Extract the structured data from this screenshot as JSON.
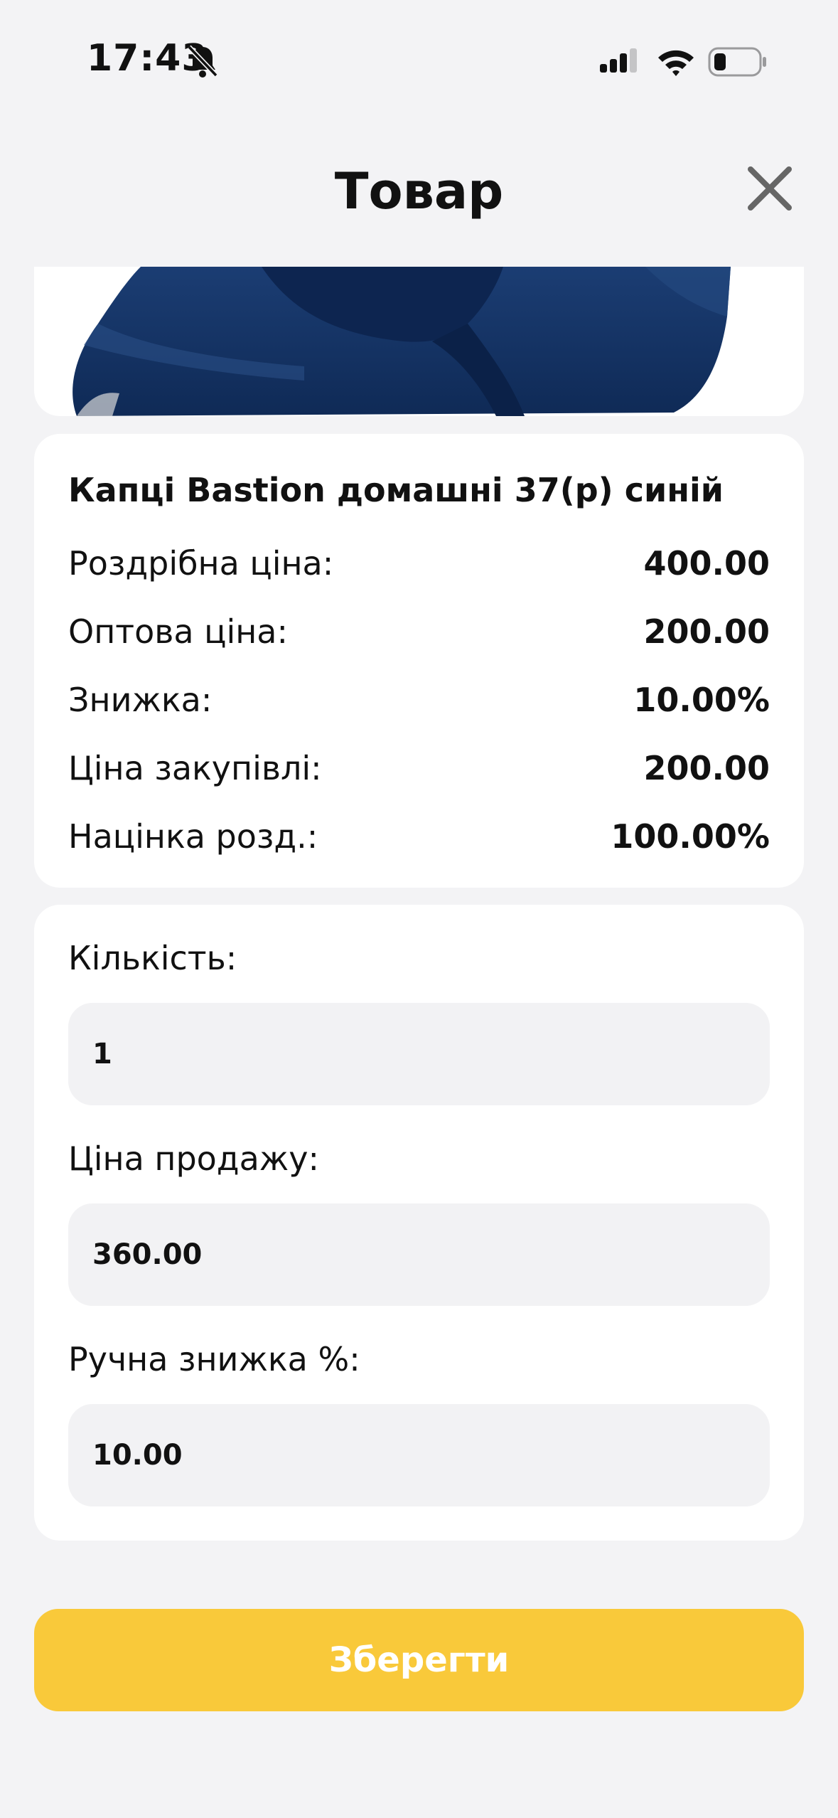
{
  "status_bar": {
    "time": "17:43",
    "icons": [
      "bell-muted-icon",
      "signal-icon",
      "wifi-icon",
      "battery-icon"
    ]
  },
  "header": {
    "title": "Товар",
    "close_icon": "close-icon"
  },
  "product": {
    "image_icon": "slippers-image",
    "name": "Капці Bastion домашні 37(р) синій",
    "rows": [
      {
        "label": "Роздрібна ціна:",
        "value": "400.00"
      },
      {
        "label": "Оптова ціна:",
        "value": "200.00"
      },
      {
        "label": "Знижка:",
        "value": "10.00%"
      },
      {
        "label": "Ціна закупівлі:",
        "value": "200.00"
      },
      {
        "label": "Націнка розд.:",
        "value": "100.00%"
      }
    ]
  },
  "form": {
    "quantity": {
      "label": "Кількість:",
      "value": "1"
    },
    "sale_price": {
      "label": "Ціна продажу:",
      "value": "360.00"
    },
    "manual_discount": {
      "label": "Ручна знижка %:",
      "value": "10.00"
    }
  },
  "actions": {
    "save_label": "Зберегти"
  },
  "colors": {
    "background": "#f3f3f5",
    "card": "#ffffff",
    "input": "#f2f2f4",
    "accent": "#f9c93a",
    "product_blue": "#1e3f73"
  }
}
